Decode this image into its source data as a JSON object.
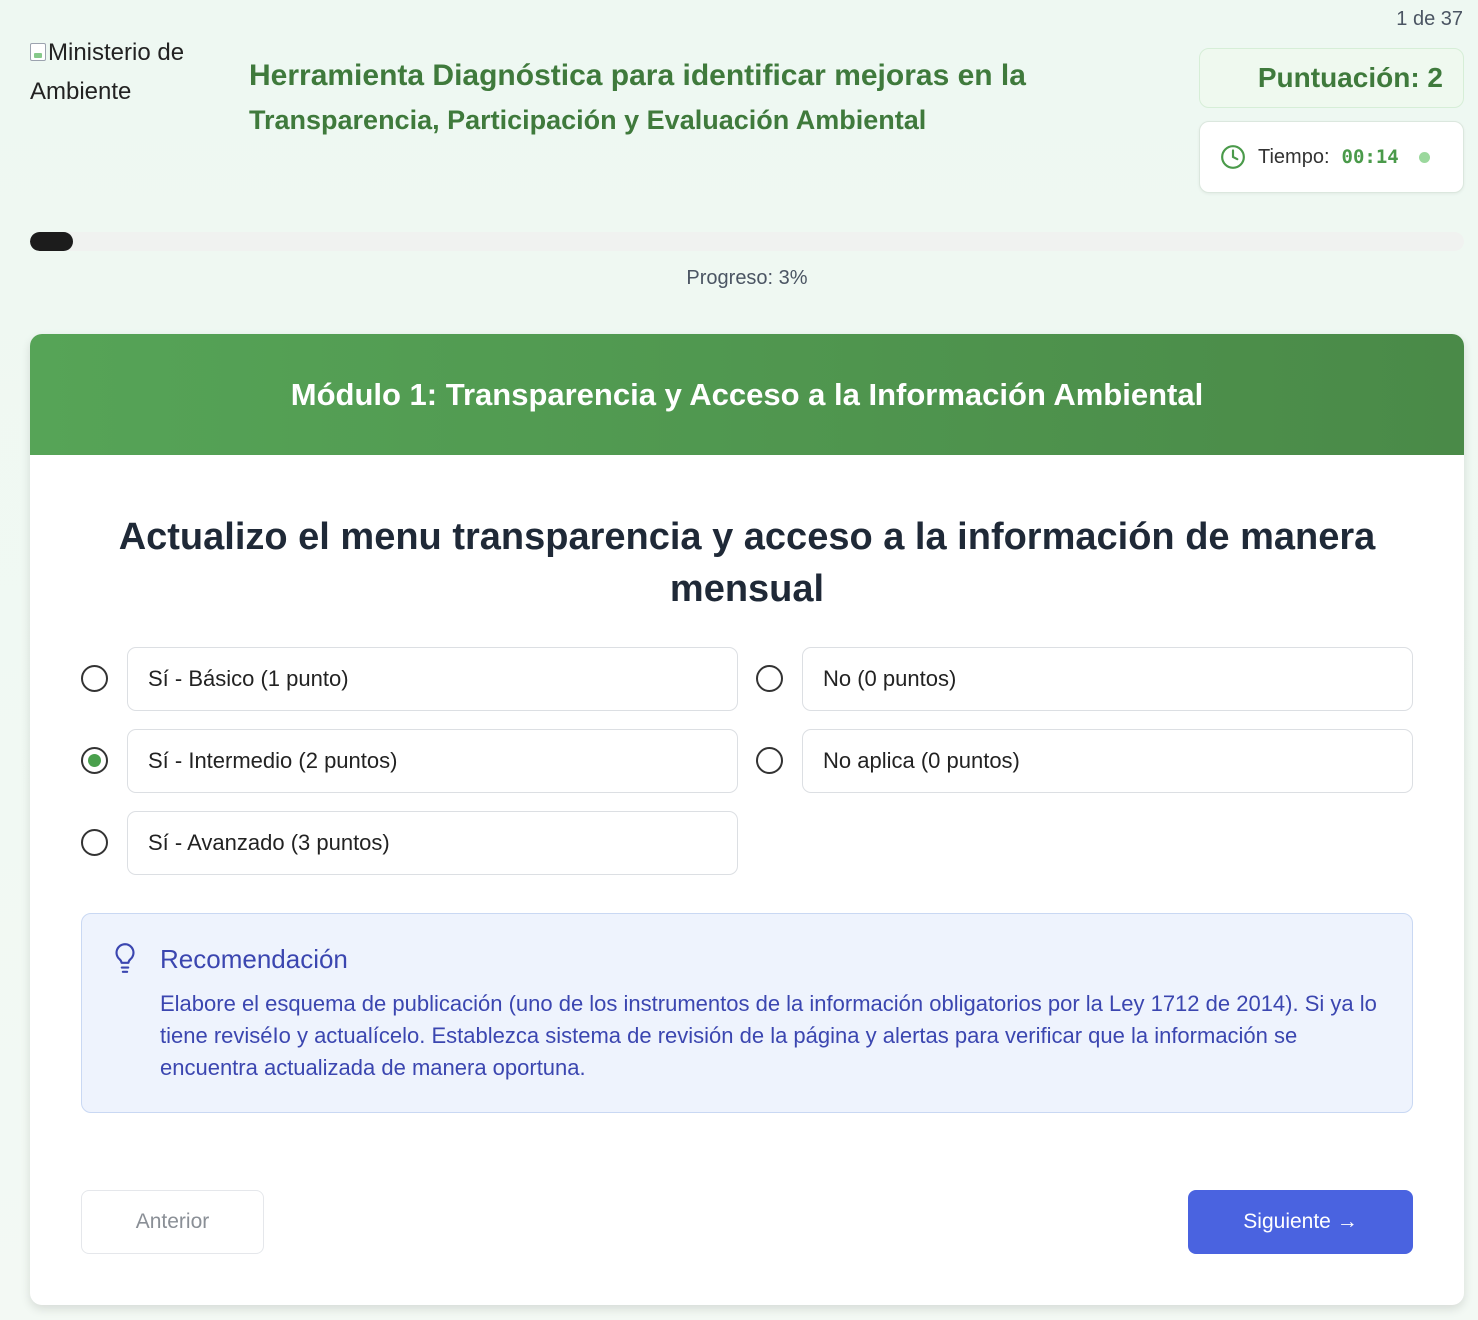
{
  "header": {
    "step_counter": "1 de 37",
    "logo_alt": "Ministerio de Ambiente",
    "title_line1": "Herramienta Diagnóstica para identificar mejoras en la",
    "title_line2": "Transparencia, Participación y Evaluación Ambiental",
    "score_label": "Puntuación: 2",
    "timer_label": "Tiempo:",
    "timer_value": "00:14"
  },
  "progress": {
    "percent": 3,
    "label": "Progreso: 3%"
  },
  "module": {
    "title": "Módulo 1: Transparencia y Acceso a la Información Ambiental"
  },
  "question": {
    "text": "Actualizo el menu transparencia y acceso a la información de manera mensual",
    "options": [
      {
        "label": "Sí - Básico (1 punto)",
        "selected": false
      },
      {
        "label": "No (0 puntos)",
        "selected": false
      },
      {
        "label": "Sí - Intermedio (2 puntos)",
        "selected": true
      },
      {
        "label": "No aplica (0 puntos)",
        "selected": false
      },
      {
        "label": "Sí - Avanzado (3 puntos)",
        "selected": false
      }
    ]
  },
  "recommendation": {
    "title": "Recomendación",
    "text": "Elabore el esquema de publicación (uno de los instrumentos de la información obligatorios por la Ley 1712 de 2014). Si ya lo tiene reviséIo y actualícelo. Establezca sistema de revisión de la página y alertas para verificar que la información se encuentra actualizada de manera oportuna."
  },
  "navigation": {
    "prev_label": "Anterior",
    "next_label": "Siguiente →"
  },
  "colors": {
    "brand_green": "#3f7a3c",
    "header_green": "#56a457",
    "accent_blue": "#4a63e0",
    "reco_text": "#3b46b0"
  }
}
